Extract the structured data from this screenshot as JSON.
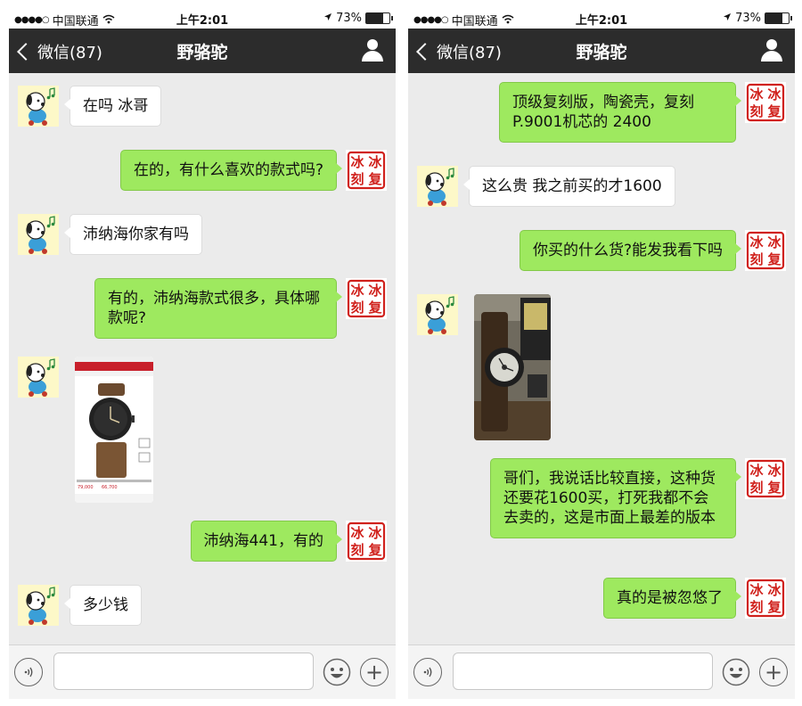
{
  "status_bar": {
    "signal_dots": "●●●●○",
    "carrier": "中国联通",
    "time": "上午2:01",
    "battery_text": "73%",
    "battery_level": 0.73
  },
  "nav": {
    "back_label": "微信(87)",
    "title": "野骆驼"
  },
  "outgoing_avatar_text": "冰冰复刻",
  "left_messages": [
    {
      "dir": "in",
      "text": "在吗 冰哥"
    },
    {
      "dir": "out",
      "text": "在的，有什么喜欢的款式吗?"
    },
    {
      "dir": "in",
      "text": "沛纳海你家有吗"
    },
    {
      "dir": "out",
      "text": "有的，沛纳海款式很多，具体哪款呢?"
    },
    {
      "dir": "in",
      "image": "product-screenshot-image",
      "caption_prices": [
        "79,000",
        "66,700"
      ]
    },
    {
      "dir": "out",
      "text": "沛纳海441，有的"
    },
    {
      "dir": "in",
      "text": "多少钱"
    }
  ],
  "right_messages": [
    {
      "dir": "out",
      "text": "顶级复刻版，陶瓷壳，复刻P.9001机芯的 2400"
    },
    {
      "dir": "in",
      "text": "这么贵 我之前买的才1600"
    },
    {
      "dir": "out",
      "text": "你买的什么货?能发我看下吗"
    },
    {
      "dir": "in",
      "image": "watch-photo-image"
    },
    {
      "dir": "out",
      "text": "哥们，我说话比较直接，这种货还要花1600买，打死我都不会去卖的，这是市面上最差的版本"
    },
    {
      "dir": "out",
      "text": "真的是被忽悠了"
    }
  ],
  "icons": {
    "back": "chevron-left-icon",
    "contact": "person-icon",
    "voice": "voice-icon",
    "emoji": "emoji-icon",
    "more": "plus-icon",
    "wifi": "wifi-icon",
    "location": "location-arrow-icon",
    "battery": "battery-icon"
  },
  "colors": {
    "nav_bg": "#2c2c2c",
    "chat_bg": "#ebebeb",
    "outgoing_bubble": "#9ee95f",
    "incoming_bubble": "#ffffff",
    "seal_red": "#d0211c"
  }
}
